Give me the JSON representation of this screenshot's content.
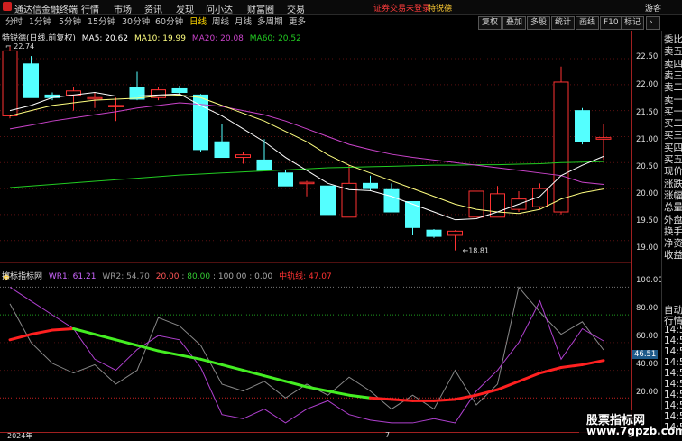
{
  "app": {
    "title": "通达信金融终端"
  },
  "menu": [
    "行情",
    "市场",
    "资讯",
    "发现",
    "问小达",
    "财富圈",
    "交易"
  ],
  "alert": "证券交易未登录",
  "user": "特锐德",
  "guest": "游客",
  "periods": [
    "分时",
    "1分钟",
    "5分钟",
    "15分钟",
    "30分钟",
    "60分钟",
    "日线",
    "周线",
    "月线",
    "多周期",
    "更多"
  ],
  "active_period": "日线",
  "right_tools": [
    "复权",
    "叠加",
    "多股",
    "统计",
    "画线",
    "F10",
    "标记"
  ],
  "main_legend": {
    "stock": "特锐德(日线,前复权)",
    "ma5": "MA5: 20.62",
    "ma10": "MA10: 19.99",
    "ma20": "MA20: 20.08",
    "ma60": "MA60: 20.52"
  },
  "indicator_legend": {
    "name": "擦标指标网",
    "wr1": "WR1: 61.21",
    "wr2": "WR2: 54.70",
    "lvl20": "20.00",
    "lvl80": "80.00",
    "lvl100": "100.00",
    "lvl0": "0.00",
    "mid": "中轨线: 47.07"
  },
  "annotations": {
    "high": "22.74",
    "low": "18.81"
  },
  "price_axis": [
    "22.50",
    "22.00",
    "21.50",
    "21.00",
    "20.50",
    "20.00",
    "19.50",
    "19.00"
  ],
  "indicator_axis": [
    "100.00",
    "80.00",
    "60.00",
    "40.00",
    "20.00"
  ],
  "indicator_value_tag": "46.51",
  "side_labels_1": [
    "委比",
    "卖五",
    "卖四",
    "卖三",
    "卖二",
    "卖一",
    "买一",
    "买二",
    "买三",
    "买四",
    "买五",
    "现价",
    "涨跌",
    "涨幅",
    "总量",
    "外盘",
    "换手",
    "净资",
    "收益"
  ],
  "side_labels_2": [
    "自动",
    "行情",
    "14:5",
    "14:5",
    "14:5",
    "14:5",
    "14:5",
    "14:5",
    "14:5",
    "14:5",
    "14:5",
    "14:5"
  ],
  "bottom_labels": {
    "year": "2024年",
    "month": "7"
  },
  "watermark": {
    "line1": "股票指标网",
    "line2": "www.7gpzb.com"
  },
  "colors": {
    "up": "#ff3232",
    "down": "#54ffff",
    "ma5": "#ffffff",
    "ma10": "#ffff80",
    "ma20": "#cc44cc",
    "ma60": "#22cc22"
  },
  "chart_data": {
    "type": "candlestick",
    "ylim": [
      18.7,
      22.9
    ],
    "candles": [
      {
        "o": 21.4,
        "h": 22.74,
        "l": 21.35,
        "c": 22.65
      },
      {
        "o": 22.4,
        "h": 22.55,
        "l": 21.75,
        "c": 21.75
      },
      {
        "o": 21.8,
        "h": 21.85,
        "l": 21.7,
        "c": 21.75
      },
      {
        "o": 21.8,
        "h": 21.95,
        "l": 21.5,
        "c": 21.88
      },
      {
        "o": 21.75,
        "h": 21.85,
        "l": 21.55,
        "c": 21.75
      },
      {
        "o": 21.6,
        "h": 21.75,
        "l": 21.3,
        "c": 21.6
      },
      {
        "o": 21.95,
        "h": 22.25,
        "l": 21.7,
        "c": 21.72
      },
      {
        "o": 21.75,
        "h": 21.95,
        "l": 21.7,
        "c": 21.9
      },
      {
        "o": 21.92,
        "h": 21.98,
        "l": 21.8,
        "c": 21.85
      },
      {
        "o": 21.8,
        "h": 21.82,
        "l": 20.7,
        "c": 20.75
      },
      {
        "o": 20.9,
        "h": 21.25,
        "l": 20.6,
        "c": 20.6
      },
      {
        "o": 20.6,
        "h": 20.7,
        "l": 20.48,
        "c": 20.65
      },
      {
        "o": 20.55,
        "h": 20.95,
        "l": 20.35,
        "c": 20.35
      },
      {
        "o": 20.3,
        "h": 20.35,
        "l": 20.05,
        "c": 20.05
      },
      {
        "o": 20.1,
        "h": 20.15,
        "l": 19.85,
        "c": 20.12
      },
      {
        "o": 20.05,
        "h": 20.05,
        "l": 19.5,
        "c": 19.5
      },
      {
        "o": 19.45,
        "h": 20.45,
        "l": 19.45,
        "c": 20.1
      },
      {
        "o": 20.1,
        "h": 20.25,
        "l": 19.95,
        "c": 20.0
      },
      {
        "o": 19.98,
        "h": 20.1,
        "l": 19.55,
        "c": 19.55
      },
      {
        "o": 19.75,
        "h": 19.75,
        "l": 19.1,
        "c": 19.25
      },
      {
        "o": 19.2,
        "h": 19.22,
        "l": 19.05,
        "c": 19.08
      },
      {
        "o": 19.1,
        "h": 19.2,
        "l": 18.81,
        "c": 19.18
      },
      {
        "o": 19.45,
        "h": 19.95,
        "l": 19.45,
        "c": 19.95
      },
      {
        "o": 19.45,
        "h": 20.05,
        "l": 19.45,
        "c": 19.9
      },
      {
        "o": 19.6,
        "h": 19.95,
        "l": 19.55,
        "c": 19.8
      },
      {
        "o": 19.65,
        "h": 20.1,
        "l": 19.6,
        "c": 20.0
      },
      {
        "o": 19.55,
        "h": 22.35,
        "l": 19.5,
        "c": 22.05
      },
      {
        "o": 21.5,
        "h": 21.55,
        "l": 20.85,
        "c": 20.9
      },
      {
        "o": 20.95,
        "h": 21.25,
        "l": 20.55,
        "c": 20.98
      }
    ],
    "ma5": [
      21.5,
      21.6,
      21.75,
      21.8,
      21.85,
      21.78,
      21.78,
      21.8,
      21.82,
      21.6,
      21.4,
      21.15,
      20.9,
      20.6,
      20.35,
      20.1,
      19.98,
      19.96,
      19.85,
      19.7,
      19.55,
      19.4,
      19.42,
      19.55,
      19.7,
      19.85,
      20.25,
      20.45,
      20.62
    ],
    "ma10": [
      21.4,
      21.5,
      21.6,
      21.65,
      21.7,
      21.72,
      21.74,
      21.78,
      21.8,
      21.75,
      21.6,
      21.45,
      21.3,
      21.1,
      20.9,
      20.65,
      20.45,
      20.3,
      20.15,
      20.0,
      19.85,
      19.7,
      19.6,
      19.55,
      19.52,
      19.6,
      19.8,
      19.92,
      19.99
    ],
    "ma20": [
      21.15,
      21.22,
      21.3,
      21.36,
      21.42,
      21.48,
      21.55,
      21.6,
      21.65,
      21.62,
      21.58,
      21.5,
      21.42,
      21.3,
      21.15,
      21.0,
      20.85,
      20.75,
      20.66,
      20.6,
      20.55,
      20.5,
      20.45,
      20.4,
      20.35,
      20.3,
      20.25,
      20.12,
      20.08
    ],
    "ma60": [
      20.02,
      20.05,
      20.08,
      20.11,
      20.14,
      20.17,
      20.2,
      20.23,
      20.26,
      20.28,
      20.3,
      20.32,
      20.34,
      20.36,
      20.38,
      20.4,
      20.41,
      20.42,
      20.43,
      20.44,
      20.45,
      20.45,
      20.46,
      20.46,
      20.47,
      20.48,
      20.5,
      20.51,
      20.52
    ],
    "indicator": {
      "ylim": [
        0,
        112
      ],
      "levels": [
        20,
        80,
        100
      ],
      "wr1": [
        100,
        90,
        80,
        70,
        48,
        40,
        55,
        65,
        62,
        42,
        8,
        5,
        12,
        2,
        12,
        18,
        8,
        4,
        2,
        2,
        5,
        2,
        25,
        40,
        60,
        90,
        48,
        70,
        61.21
      ],
      "wr2": [
        88,
        60,
        45,
        38,
        44,
        30,
        40,
        78,
        72,
        58,
        30,
        25,
        32,
        20,
        30,
        22,
        35,
        25,
        12,
        22,
        12,
        40,
        15,
        30,
        100,
        82,
        66,
        75,
        54.7
      ],
      "mid": [
        62,
        66,
        69,
        70,
        66,
        62,
        58,
        54,
        51,
        48,
        44,
        40,
        36,
        32,
        28,
        25,
        22,
        20,
        19,
        18,
        18,
        19,
        22,
        26,
        32,
        38,
        42,
        44,
        47.07
      ],
      "mid_colors": [
        "up",
        "up",
        "up",
        "up",
        "down",
        "down",
        "down",
        "down",
        "down",
        "down",
        "down",
        "down",
        "down",
        "down",
        "down",
        "down",
        "down",
        "down",
        "up",
        "up",
        "up",
        "up",
        "up",
        "up",
        "up",
        "up",
        "up",
        "up",
        "up"
      ]
    }
  }
}
